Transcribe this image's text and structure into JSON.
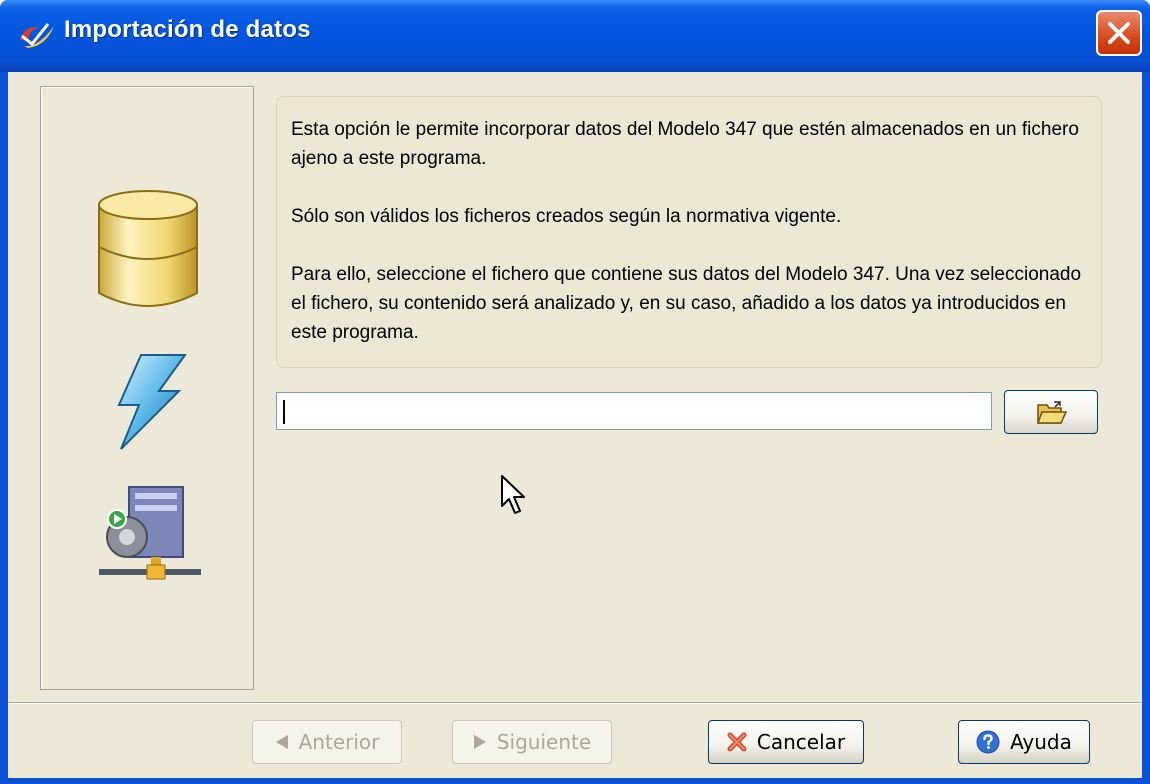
{
  "window": {
    "title": "Importación de datos",
    "close_icon": "close-icon"
  },
  "info": {
    "paragraph1": "Esta opción le permite incorporar datos del Modelo 347 que estén almacenados en un fichero ajeno a este programa.",
    "paragraph2": "Sólo son válidos los ficheros creados según la normativa vigente.",
    "paragraph3": "Para ello, seleccione el fichero que contiene sus datos del Modelo 347. Una vez seleccionado el fichero, su contenido será analizado y, en su caso, añadido a los datos ya introducidos en este programa."
  },
  "file_input": {
    "value": ""
  },
  "sidebar_icons": [
    "database-icon",
    "lightning-icon",
    "network-server-icon"
  ],
  "buttons": {
    "previous": {
      "label": "Anterior",
      "enabled": false
    },
    "next": {
      "label": "Siguiente",
      "enabled": false
    },
    "cancel": {
      "label": "Cancelar",
      "enabled": true
    },
    "help": {
      "label": "Ayuda",
      "enabled": true
    }
  },
  "colors": {
    "titlebar": "#0255de",
    "dialog_background": "#ece9d8",
    "close_button": "#d9481c"
  }
}
